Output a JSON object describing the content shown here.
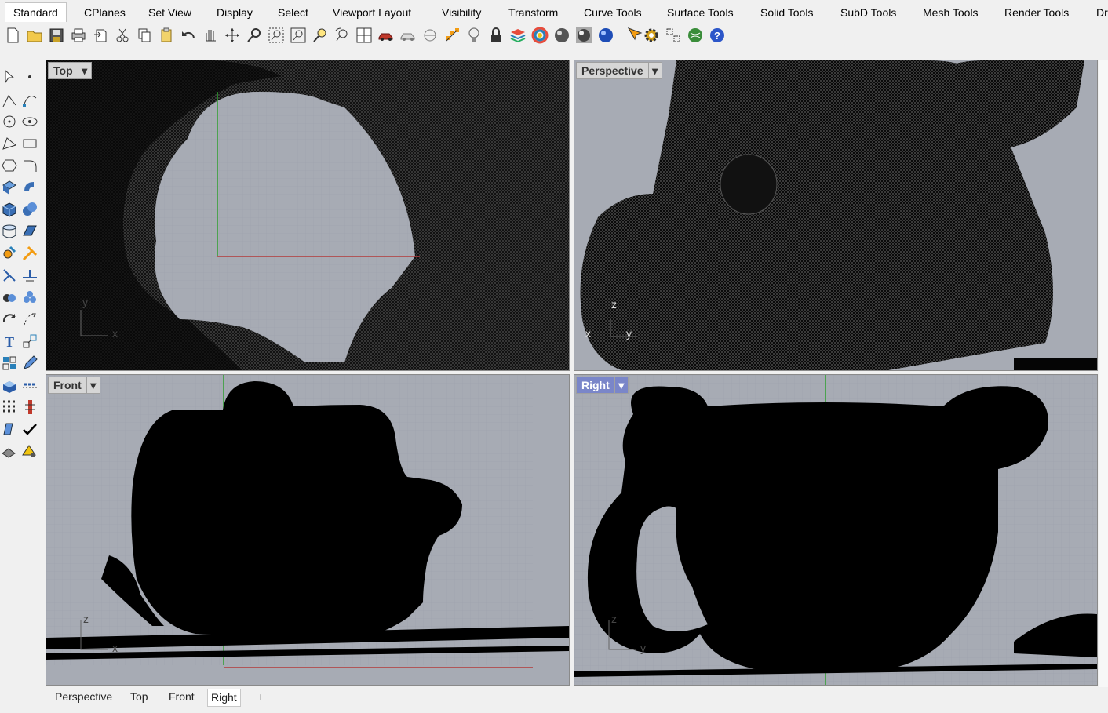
{
  "ribbon": {
    "tabs": [
      "Standard",
      "CPlanes",
      "Set View",
      "Display",
      "Select",
      "Viewport Layout",
      "Visibility",
      "Transform",
      "Curve Tools",
      "Surface Tools",
      "Solid Tools",
      "SubD Tools",
      "Mesh Tools",
      "Render Tools",
      "Dr"
    ],
    "active_tab": "Standard"
  },
  "toolbar": {
    "icons": [
      "new-file-icon",
      "open-folder-icon",
      "save-icon",
      "print-icon",
      "import-icon",
      "cut-icon",
      "copy-icon",
      "paste-icon",
      "undo-icon",
      "pan-hand-icon",
      "rotate-view-icon",
      "zoom-icon",
      "zoom-window-icon",
      "zoom-extents-icon",
      "zoom-selected-icon",
      "undo-view-icon",
      "four-viewports-icon",
      "car-icon",
      "car-outline-icon",
      "circle-icon",
      "points-icon",
      "lightbulb-icon",
      "lock-icon",
      "layer-icon",
      "color-wheel-icon",
      "shaded-sphere-icon",
      "rendered-sphere-icon",
      "blue-sphere-icon",
      "cursor-snap-icon",
      "gear-icon",
      "grid-snap-icon",
      "globe-icon",
      "help-icon"
    ]
  },
  "viewports": {
    "top": {
      "label": "Top",
      "axis1": "y",
      "axis2": "x"
    },
    "perspective": {
      "label": "Perspective",
      "axis1": "z",
      "axis2": "x",
      "axis3": "y"
    },
    "front": {
      "label": "Front",
      "axis1": "z",
      "axis2": "x"
    },
    "right": {
      "label": "Right",
      "axis1": "z",
      "axis2": "y"
    }
  },
  "bottom_tabs": [
    "Perspective",
    "Top",
    "Front",
    "Right"
  ],
  "active_bottom_tab": "Right",
  "add_tab_glyph": "+",
  "colors": {
    "viewport_bg": "#a7abb4",
    "grid_line": "#9ca0a8",
    "grid_major": "#8d9199",
    "x_axis": "#b33a3a",
    "y_axis": "#3aa03a",
    "mesh": "#000000",
    "selected_label": "#7a86c9"
  }
}
